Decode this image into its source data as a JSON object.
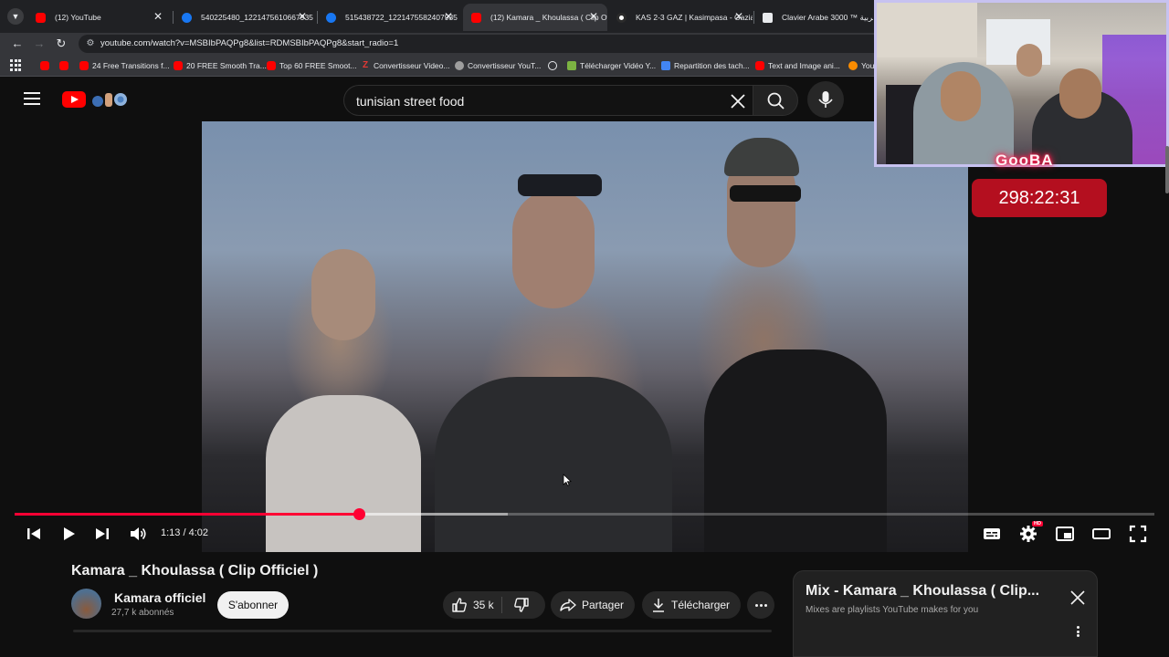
{
  "browser": {
    "tabs": [
      {
        "label": "(12) YouTube",
        "favicon": "youtube-icon"
      },
      {
        "label": "540225480_1221475610667935",
        "favicon": "facebook-icon"
      },
      {
        "label": "515438722_1221475582407935",
        "favicon": "facebook-icon"
      },
      {
        "label": "(12) Kamara _ Khoulassa ( Clip Officiel )",
        "favicon": "youtube-icon",
        "active": true
      },
      {
        "label": "KAS 2-3 GAZ | Kasimpasa - Gaziantep",
        "favicon": "kas-icon"
      },
      {
        "label": "Clavier Arabe 3000 ™ بالعربية",
        "favicon": "clavier-icon"
      }
    ],
    "url": "youtube.com/watch?v=MSBIbPAQPg8&list=RDMSBIbPAQPg8&start_radio=1",
    "bookmarks": [
      {
        "label": "",
        "icon": "youtube-icon"
      },
      {
        "label": "",
        "icon": "youtube-icon"
      },
      {
        "label": "24 Free Transitions f...",
        "icon": "youtube-icon"
      },
      {
        "label": "20 FREE Smooth Tra...",
        "icon": "youtube-icon"
      },
      {
        "label": "Top 60 FREE Smoot...",
        "icon": "youtube-icon"
      },
      {
        "label": "Convertisseur Video...",
        "icon": "z-icon"
      },
      {
        "label": "Convertisseur YouT...",
        "icon": "converter-icon"
      },
      {
        "label": "",
        "icon": "globe-icon"
      },
      {
        "label": "Télécharger Vidéo Y...",
        "icon": "download-icon"
      },
      {
        "label": "Repartition des tach...",
        "icon": "doc-icon"
      },
      {
        "label": "Text and Image ani...",
        "icon": "youtube-icon"
      },
      {
        "label": "You",
        "icon": "star-icon"
      }
    ]
  },
  "youtube": {
    "search_query": "tunisian street food",
    "player": {
      "current_time": "1:13",
      "duration": "4:02",
      "time_display": "1:13 / 4:02",
      "progress_fraction": 0.302,
      "buffered_fraction": 0.433,
      "quality_badge": "HD"
    },
    "video": {
      "title": "Kamara _ Khoulassa ( Clip Officiel )",
      "channel": "Kamara officiel",
      "subscribers": "27,7 k abonnés",
      "subscribe_label": "S'abonner",
      "likes": "35 k",
      "share_label": "Partager",
      "download_label": "Télécharger"
    },
    "mix": {
      "title": "Mix - Kamara _ Khoulassa ( Clip...",
      "subtitle": "Mixes are playlists YouTube makes for you"
    }
  },
  "stream_overlay": {
    "brand": "GooBA",
    "timer": "298:22:31"
  },
  "colors": {
    "accent": "#ff0033",
    "background": "#0f0f0f",
    "timer_bg": "#b40f1f"
  }
}
